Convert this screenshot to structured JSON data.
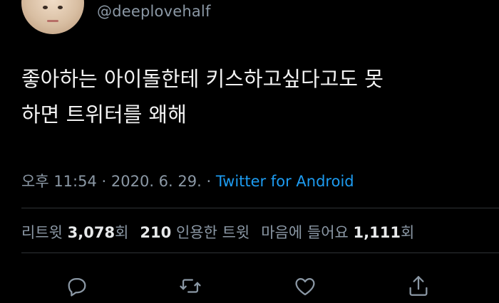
{
  "author": {
    "handle": "@deeplovehalf"
  },
  "tweet": {
    "text": "좋아하는 아이돌한테 키스하고싶다고도 못\n하면 트위터를 왜해"
  },
  "meta": {
    "time": "오후 11:54",
    "sep1": " · ",
    "date": "2020. 6. 29.",
    "sep2": " · ",
    "source": "Twitter for Android"
  },
  "stats": {
    "retweets_label": "리트윗",
    "retweets_count": "3,078",
    "retweets_unit": "회",
    "quotes_count": "210",
    "quotes_label": "인용한 트윗",
    "likes_label": "마음에 들어요",
    "likes_count": "1,111",
    "likes_unit": "회"
  },
  "actions": [
    {
      "icon": "reply-icon"
    },
    {
      "icon": "retweet-icon"
    },
    {
      "icon": "like-icon"
    },
    {
      "icon": "share-icon"
    }
  ],
  "colors": {
    "background": "#000000",
    "text": "#e7e9ea",
    "muted": "#8b98a5",
    "accent": "#1d9bf0"
  }
}
